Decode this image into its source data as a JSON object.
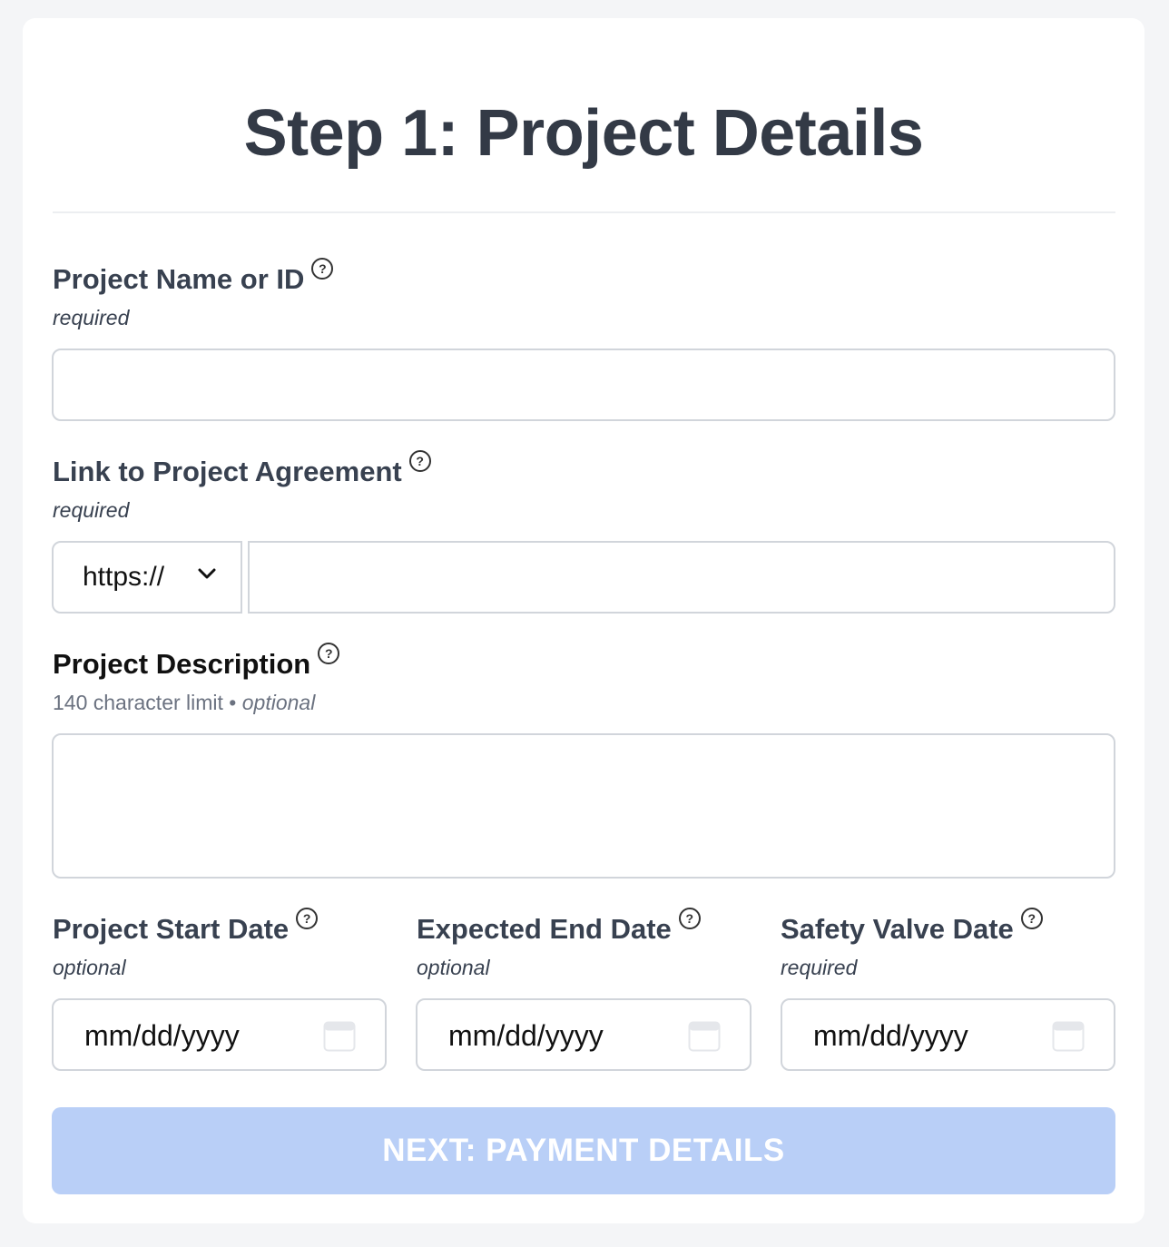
{
  "page": {
    "title": "Step 1: Project Details"
  },
  "fields": {
    "project_name": {
      "label": "Project Name or ID",
      "hint": "required",
      "value": ""
    },
    "agreement_link": {
      "label": "Link to Project Agreement",
      "hint": "required",
      "protocol": "https://",
      "value": ""
    },
    "description": {
      "label": "Project Description",
      "hint_limit": "140 character limit",
      "hint_sep": " • ",
      "hint_optional": "optional",
      "value": ""
    },
    "start_date": {
      "label": "Project Start Date",
      "hint": "optional",
      "placeholder": "mm/dd/yyyy"
    },
    "end_date": {
      "label": "Expected End Date",
      "hint": "optional",
      "placeholder": "mm/dd/yyyy"
    },
    "safety_valve_date": {
      "label": "Safety Valve Date",
      "hint": "required",
      "placeholder": "mm/dd/yyyy"
    }
  },
  "help_icon_glyph": "?",
  "next_button": {
    "label": "NEXT: PAYMENT DETAILS",
    "state": "disabled"
  },
  "icons": {
    "help": "question-circle-icon",
    "calendar": "calendar-icon",
    "dropdown": "chevron-down-icon"
  },
  "colors": {
    "page_bg": "#f4f5f7",
    "card_bg": "#ffffff",
    "button_bg_disabled": "#b9cff7",
    "text": "#384150"
  }
}
